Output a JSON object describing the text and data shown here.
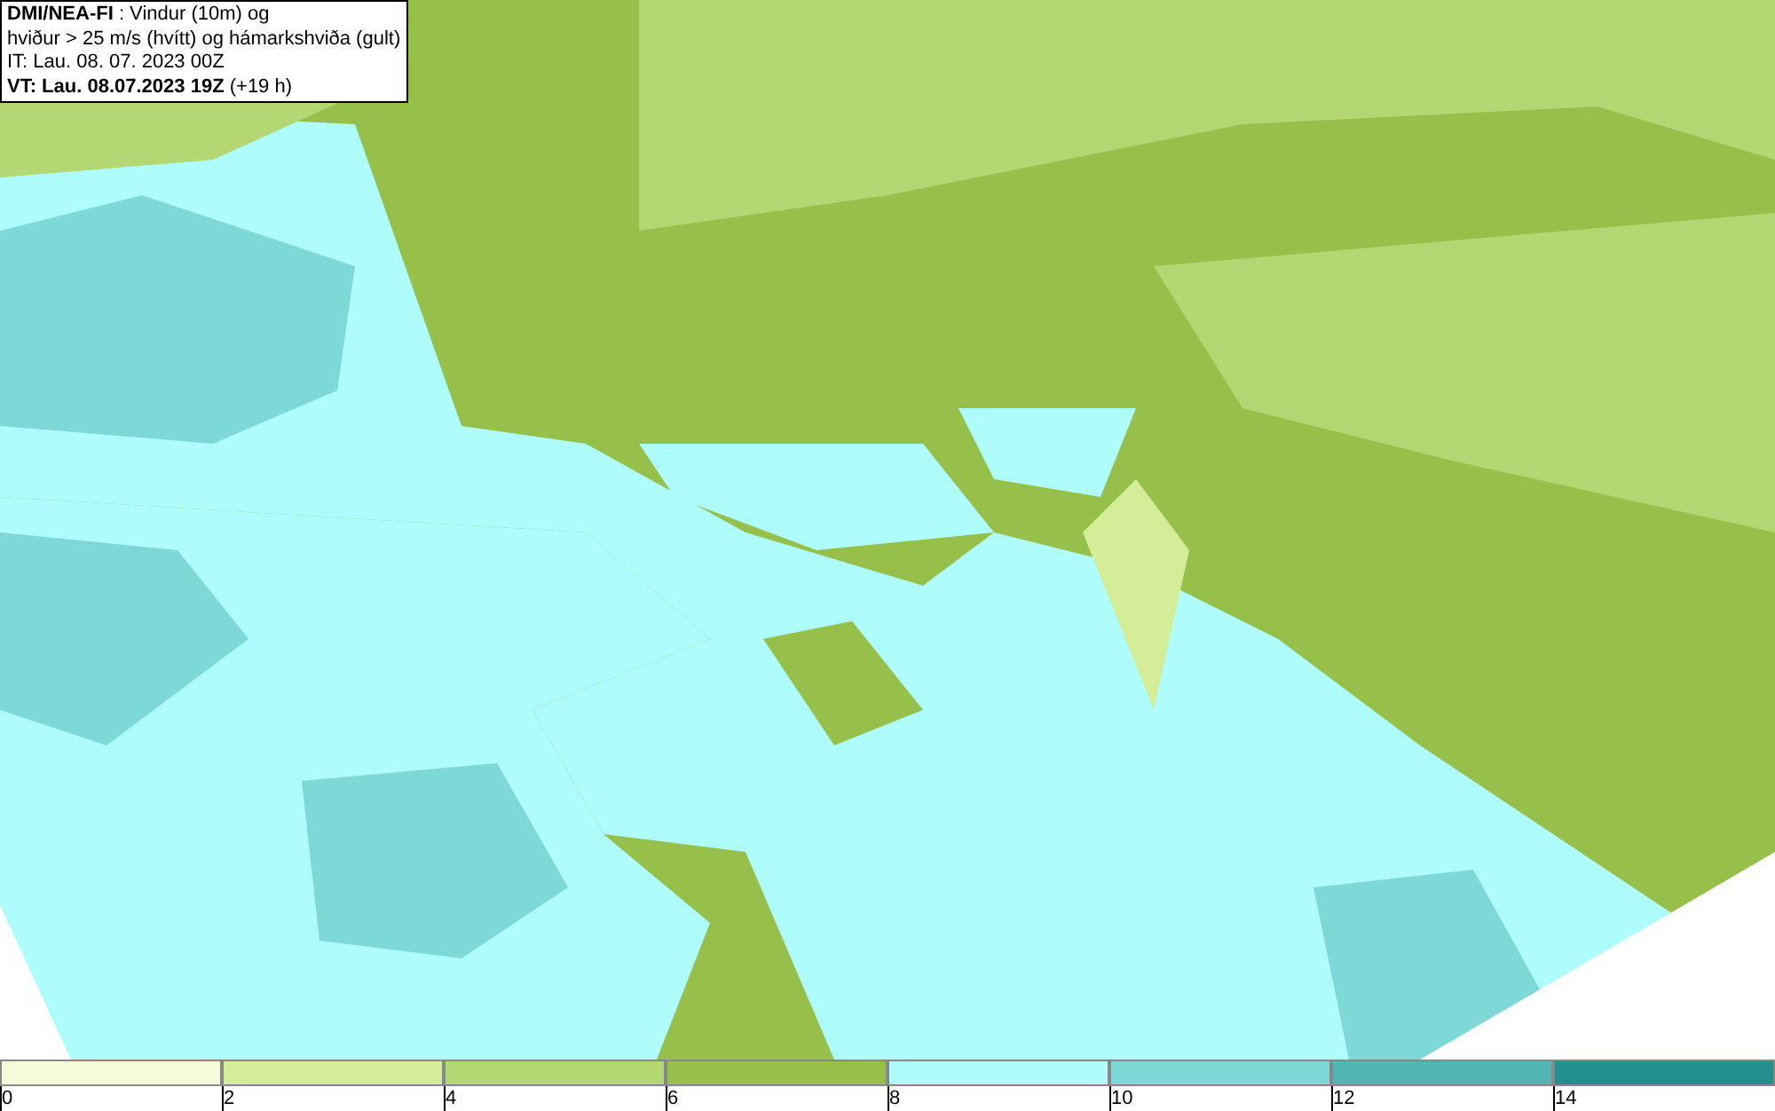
{
  "title_box": {
    "lines": [
      "**DMI/NEA-FI** : Vindur (10m) og",
      "hviður > 25 m/s (hvítt) og hámarkshviða (gult)",
      "IT: Lau. 08. 07. 2023 00Z",
      "**VT: Lau. 08.07.2023 19Z** (+19 h)"
    ]
  },
  "legend": {
    "bins": [
      {
        "color": "#f5fcdc",
        "label": "0"
      },
      {
        "color": "#d4ed98",
        "label": "2"
      },
      {
        "color": "#b3d873",
        "label": "4"
      },
      {
        "color": "#96c04a",
        "label": "6"
      },
      {
        "color": "#aefcfc",
        "label": "8"
      },
      {
        "color": "#7fd8d8",
        "label": "10"
      },
      {
        "color": "#53b4b4",
        "label": "12"
      },
      {
        "color": "#239090",
        "label": "14"
      }
    ]
  }
}
